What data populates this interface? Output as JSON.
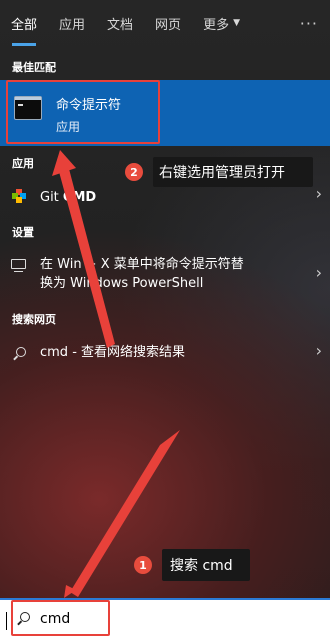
{
  "tabs": [
    {
      "label": "全部",
      "active": true
    },
    {
      "label": "应用",
      "active": false
    },
    {
      "label": "文档",
      "active": false
    },
    {
      "label": "网页",
      "active": false
    },
    {
      "label": "更多",
      "active": false
    }
  ],
  "topbar": {
    "more_arrow": "▼",
    "overflow": "···"
  },
  "sections": {
    "best_match": "最佳匹配",
    "apps": "应用",
    "settings": "设置",
    "web": "搜索网页"
  },
  "best_match": {
    "title": "命令提示符",
    "subtitle": "应用",
    "icon": "cmd-terminal-icon"
  },
  "apps_items": [
    {
      "label_prefix": "Git ",
      "label_bold": "CMD",
      "icon": "git-icon"
    }
  ],
  "settings_items": [
    {
      "line1": "在 Win + X 菜单中将命令提示符替",
      "line2": "换为 Windows PowerShell",
      "icon": "display-icon"
    }
  ],
  "web_items": [
    {
      "label": "cmd - 查看网络搜索结果",
      "icon": "search-icon"
    }
  ],
  "search": {
    "value": "cmd"
  },
  "annotations": {
    "step1_num": "1",
    "step1_text": "搜索 cmd",
    "step2_num": "2",
    "step2_text": "右键选用管理员打开"
  },
  "colors": {
    "accent": "#0e63b3",
    "tab_underline": "#4aa3e8",
    "annotation": "#e8413a",
    "badge": "#e84c3d"
  }
}
